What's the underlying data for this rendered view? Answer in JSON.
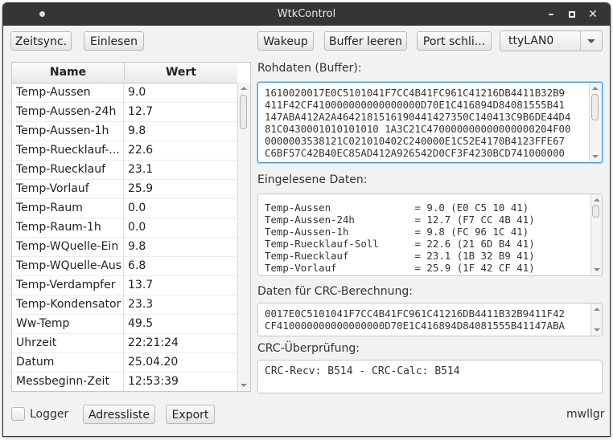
{
  "window": {
    "title": "WtkControl"
  },
  "toolbar": {
    "zeitsync": "Zeitsync.",
    "einlesen": "Einlesen",
    "wakeup": "Wakeup",
    "buffer_leeren": "Buffer leeren",
    "port_schliessen": "Port schli...",
    "port_select": {
      "value": "ttyLAN0"
    }
  },
  "table": {
    "headers": [
      "Name",
      "Wert"
    ],
    "rows": [
      [
        "Temp-Aussen",
        "9.0"
      ],
      [
        "Temp-Aussen-24h",
        "12.7"
      ],
      [
        "Temp-Aussen-1h",
        "9.8"
      ],
      [
        "Temp-Ruecklauf-...",
        "22.6"
      ],
      [
        "Temp-Ruecklauf",
        "23.1"
      ],
      [
        "Temp-Vorlauf",
        "25.9"
      ],
      [
        "Temp-Raum",
        "0.0"
      ],
      [
        "Temp-Raum-1h",
        "0.0"
      ],
      [
        "Temp-WQuelle-Ein",
        "9.8"
      ],
      [
        "Temp-WQuelle-Aus",
        "6.8"
      ],
      [
        "Temp-Verdampfer",
        "13.7"
      ],
      [
        "Temp-Kondensator",
        "23.3"
      ],
      [
        "Ww-Temp",
        "49.5"
      ],
      [
        "Uhrzeit",
        "22:21:24"
      ],
      [
        "Datum",
        "25.04.20"
      ],
      [
        "Messbeginn-Zeit",
        "12:53:39"
      ]
    ]
  },
  "rohdaten": {
    "label": "Rohdaten (Buffer):",
    "lines": [
      "1610020017E0C5101041F7CC4B41FC961C41216DB4411B32B9",
      "411F42CF410000000000000000D70E1C416894D84081555B41",
      "147ABA412A2A4642181516190441427350C140413C9B6DE44D4",
      "81C0430001010101010 1A3C21C470000000000000000204F00",
      "0000003538121C021010402C240000E1C52E4170B4123FFE67",
      "C6BF57C42B40EC85AD412A926542D0CF3F4230BCD741000000"
    ]
  },
  "eingelesene": {
    "label": "Eingelesene Daten:",
    "lines": [
      "Temp-Aussen              = 9.0 (E0 C5 10 41)",
      "Temp-Aussen-24h          = 12.7 (F7 CC 4B 41)",
      "Temp-Aussen-1h           = 9.8 (FC 96 1C 41)",
      "Temp-Ruecklauf-Soll      = 22.6 (21 6D B4 41)",
      "Temp-Ruecklauf           = 23.1 (1B 32 B9 41)",
      "Temp-Vorlauf             = 25.9 (1F 42 CF 41)"
    ]
  },
  "crc_daten": {
    "label": "Daten für CRC-Berechnung:",
    "lines": [
      "0017E0C5101041F7CC4B41FC961C41216DB4411B32B9411F42",
      "CF410000000000000000D70E1C416894D84081555B41147ABA"
    ]
  },
  "crc_pruefung": {
    "label": "CRC-Überprüfung:",
    "value": "CRC-Recv: B514 - CRC-Calc: B514"
  },
  "footer": {
    "logger": "Logger",
    "adressliste": "Adressliste",
    "export": "Export",
    "user": "mwllgr"
  }
}
